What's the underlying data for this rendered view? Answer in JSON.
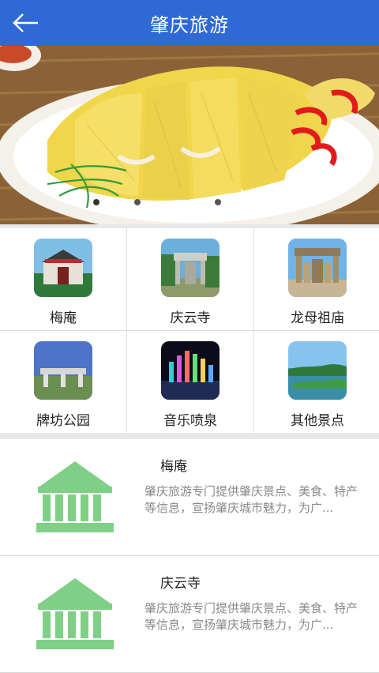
{
  "header": {
    "title": "肇庆旅游",
    "back_icon": "arrow-left-icon"
  },
  "banner": {
    "alt": "food banner",
    "slide_count": 3,
    "active_index": 0
  },
  "categories": [
    {
      "label": "梅庵"
    },
    {
      "label": "庆云寺"
    },
    {
      "label": "龙母祖庙"
    },
    {
      "label": "牌坊公园"
    },
    {
      "label": "音乐喷泉"
    },
    {
      "label": "其他景点"
    }
  ],
  "list": [
    {
      "name": "梅庵",
      "desc": "肇庆旅游专门提供肇庆景点、美食、特产等信息，宣扬肇庆城市魅力，为广..."
    },
    {
      "name": "庆云寺",
      "desc": "肇庆旅游专门提供肇庆景点、美食、特产等信息，宣扬肇庆城市魅力，为广..."
    }
  ],
  "colors": {
    "header": "#2f69d4",
    "temple_icon": "#7fd086"
  }
}
